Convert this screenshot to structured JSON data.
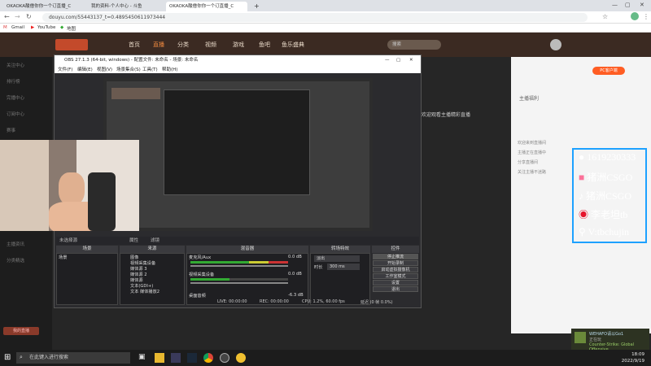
{
  "browser": {
    "tabs": [
      {
        "label": "OKAOKA酸僧你你一个订直播_C"
      },
      {
        "label": "我的资料-个人中心 - 斗鱼"
      },
      {
        "label": "OKAOKA酸僧你你一个订直播_C"
      }
    ],
    "new_tab": "+",
    "url": "douyu.com/55443137_t=0.4895450611973444",
    "bookmarks": [
      "Gmail",
      "YouTube",
      "地图"
    ]
  },
  "site": {
    "nav": [
      "首页",
      "直播",
      "分类",
      "视频",
      "游戏",
      "鱼吧",
      "鱼乐盛典"
    ],
    "search_placeholder": "搜索",
    "left_items": [
      "关注中心",
      "排行榜",
      "完播中心",
      "订阅中心",
      "赛事",
      "主播资讯",
      "分类精选",
      "我的直播"
    ],
    "room_title": "欢迎观看主播精彩直播",
    "tag": "PC客户端",
    "right_title": "主播福利",
    "chat": [
      "欢迎来到直播间",
      "主播正在直播中",
      "分享直播间",
      "关注主播不迷路"
    ]
  },
  "obs": {
    "title": "OBS 27.1.3 (64-bit, windows) - 配置文件: 未命名 - 场景: 未命名",
    "menu": [
      "文件(F)",
      "编辑(E)",
      "视图(V)",
      "场景集合(S)",
      "工具(T)",
      "帮助(H)"
    ],
    "no_source": "未选择源",
    "props_btn": "属性",
    "filter_btn": "滤镜",
    "docks": {
      "scenes": "场景",
      "sources": "来源",
      "mixer": "混音器",
      "transitions": "转场特效",
      "controls": "控件"
    },
    "scenes": [
      "场景"
    ],
    "sources": [
      "图像",
      "视频采集设备",
      "媒体源 3",
      "媒体源 2",
      "媒体源",
      "文本(GDI+)",
      "文本 媒体播放2"
    ],
    "mixer": [
      {
        "name": "麦克风/Aux",
        "db": "0.0 dB"
      },
      {
        "name": "视频采集设备",
        "db": "0.0 dB"
      },
      {
        "name": "桌面音频",
        "db": "-6.3 dB"
      }
    ],
    "transition": "淡出",
    "duration_label": "时长",
    "duration": "300 ms",
    "controls": [
      "停止推流",
      "开始录制",
      "启动虚拟摄像机",
      "工作室模式",
      "设置",
      "退出"
    ],
    "status": {
      "live": "LIVE: 00:00:00",
      "rec": "REC: 00:00:00",
      "cpu": "CPU: 1.2%, 60.00 fps",
      "dropped": "延迟 (0 帧 0.0%)"
    }
  },
  "overlay": {
    "socials": [
      "1619230333",
      "猪洲CSGO",
      "猪洲CSGO",
      "李老坦tb",
      "V:tbchujin"
    ],
    "colors": {
      "border": "#1da1ff",
      "qq": "#ffffff",
      "bili": "#fb7299",
      "douyin": "#000000",
      "weibo": "#e6162d"
    }
  },
  "taskbar": {
    "search": "在此键入进行搜索",
    "time": "18:09",
    "date": "2022/9/19",
    "toast_title": "WEHAFO请以Go1",
    "toast_text": "正在玩",
    "toast_game": "Counter-Strike: Global Offensive"
  }
}
